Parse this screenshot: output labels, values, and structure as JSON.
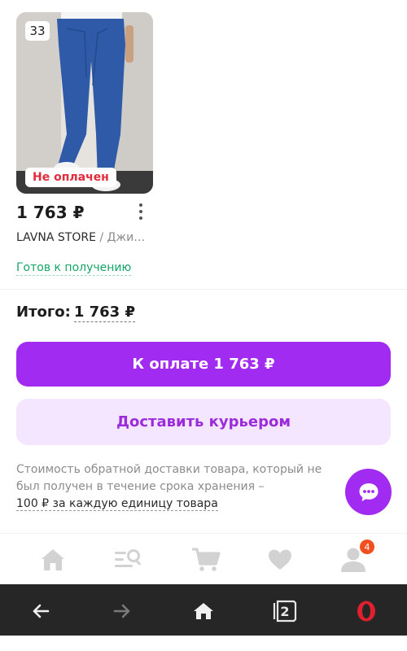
{
  "product": {
    "quantity_badge": "33",
    "payment_status_badge": "Не оплачен",
    "price": "1 763 ₽",
    "seller": "LAVNA STORE",
    "separator": " / ",
    "category": "Джи…",
    "status": "Готов к получению",
    "image_icon": "jeans-photo"
  },
  "summary": {
    "total_label": "Итого:",
    "total_amount": "1 763 ₽"
  },
  "actions": {
    "pay_label": "К оплате 1 763 ₽",
    "courier_label": "Доставить курьером"
  },
  "note": {
    "text": "Стоимость обратной доставки товара, который не был получен в течение срока хранения –",
    "link_text": "100 ₽ за каждую единицу товара"
  },
  "tabbar": {
    "items": [
      {
        "icon": "home-icon"
      },
      {
        "icon": "catalog-search-icon"
      },
      {
        "icon": "cart-icon"
      },
      {
        "icon": "heart-icon"
      },
      {
        "icon": "profile-icon",
        "badge": "4"
      }
    ]
  },
  "browser": {
    "tabs_count": "2",
    "buttons": [
      "back-arrow-icon",
      "forward-arrow-icon",
      "home-icon",
      "tabs-icon",
      "opera-icon"
    ]
  },
  "colors": {
    "accent": "#a12bf0",
    "accent_light": "#f4e6ff",
    "status_green": "#16a567",
    "unpaid_red": "#e02c3b",
    "badge_orange": "#f0501e"
  }
}
